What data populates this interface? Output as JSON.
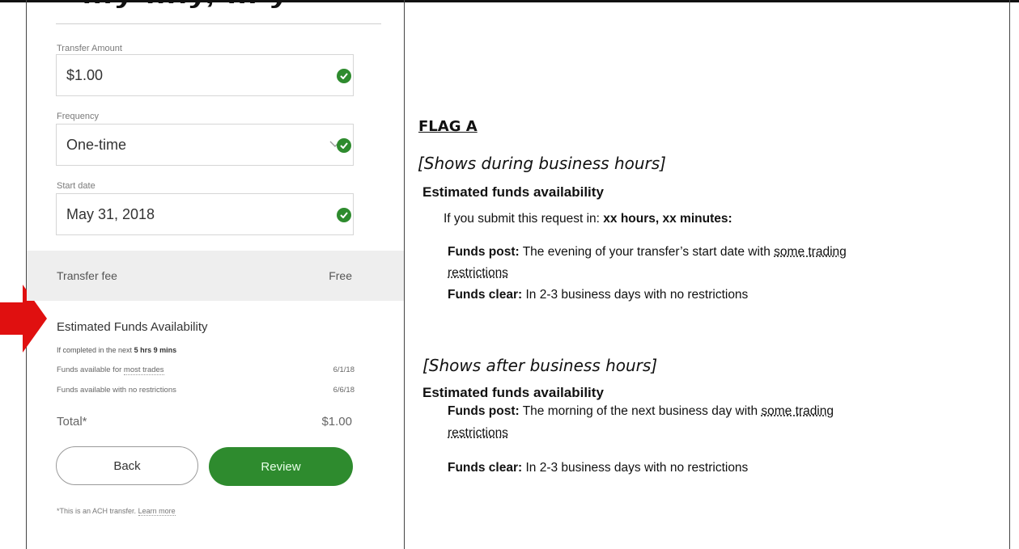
{
  "top_fragment": "…y  …ly, …  y",
  "form": {
    "transfer_amount": {
      "label": "Transfer Amount",
      "value": "$1.00"
    },
    "frequency": {
      "label": "Frequency",
      "value": "One-time"
    },
    "start_date": {
      "label": "Start date",
      "value": "May 31, 2018"
    },
    "transfer_fee": {
      "label": "Transfer fee",
      "value": "Free"
    }
  },
  "availability": {
    "title": "Estimated Funds Availability",
    "subtitle_prefix": "If completed in the next",
    "subtitle_time": "5 hrs 9 mins",
    "rows": [
      {
        "label_prefix": "Funds available for",
        "label_link": "most trades",
        "date": "6/1/18"
      },
      {
        "label_prefix": "Funds available with no restrictions",
        "label_link": "",
        "date": "6/6/18"
      }
    ]
  },
  "total": {
    "label": "Total*",
    "value": "$1.00"
  },
  "buttons": {
    "back": "Back",
    "review": "Review"
  },
  "footnote": {
    "text": "*This is an ACH transfer.",
    "link": "Learn more"
  },
  "flag": {
    "title": "FLAG A",
    "business_hours": {
      "condition": "[Shows during business hours]",
      "heading": "Estimated funds availability",
      "submit_prefix": "If you submit this request in:",
      "submit_time": "xx hours, xx minutes:",
      "post_label": "Funds post:",
      "post_text": "The evening of your transfer’s start date with",
      "post_link_1": "some trading",
      "post_link_2": "restrictions",
      "clear_label": "Funds clear:",
      "clear_text": "In 2-3 business days with no restrictions"
    },
    "after_hours": {
      "condition": "[Shows after business hours]",
      "heading": "Estimated funds availability",
      "post_label": "Funds post:",
      "post_text": "The morning of the next business day with",
      "post_link_1": "some trading",
      "post_link_2": "restrictions",
      "clear_label": "Funds clear:",
      "clear_text": "In 2-3 business days with no restrictions"
    }
  },
  "colors": {
    "accent_green": "#2e8b2e",
    "arrow_red": "#e01010"
  }
}
